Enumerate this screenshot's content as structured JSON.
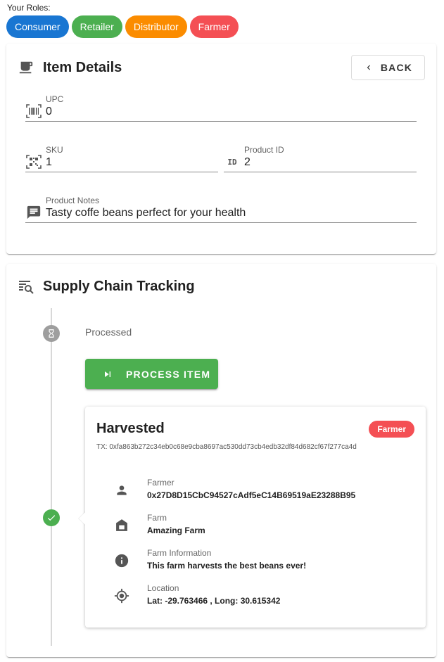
{
  "roles": {
    "label": "Your Roles:",
    "items": [
      {
        "label": "Consumer",
        "color": "#1976d2"
      },
      {
        "label": "Retailer",
        "color": "#4caf50"
      },
      {
        "label": "Distributor",
        "color": "#fb8c00"
      },
      {
        "label": "Farmer",
        "color": "#f44f54"
      }
    ]
  },
  "item_details": {
    "title": "Item Details",
    "back_label": "BACK",
    "upc": {
      "label": "UPC",
      "value": "0"
    },
    "sku": {
      "label": "SKU",
      "value": "1"
    },
    "product_id": {
      "label": "Product ID",
      "value": "2",
      "icon_text": "ID"
    },
    "product_notes": {
      "label": "Product Notes",
      "value": "Tasty coffe beans perfect for your health"
    }
  },
  "tracking": {
    "title": "Supply Chain Tracking",
    "pending_step": {
      "label": "Processed",
      "action_label": "PROCESS ITEM"
    },
    "event": {
      "title": "Harvested",
      "tag": "Farmer",
      "tx": "TX: 0xfa863b272c34eb0c68e9cba8697ac530dd73cb4edb32df84d682cf67f277ca4d",
      "rows": [
        {
          "label": "Farmer",
          "value": "0x27D8D15CbC94527cAdf5eC14B69519aE23288B95",
          "icon": "person-icon"
        },
        {
          "label": "Farm",
          "value": "Amazing Farm",
          "icon": "barn-icon"
        },
        {
          "label": "Farm Information",
          "value": "This farm harvests the best beans ever!",
          "icon": "info-icon"
        },
        {
          "label": "Location",
          "value": "Lat: -29.763466 , Long: 30.615342",
          "icon": "gps-icon"
        }
      ]
    }
  }
}
